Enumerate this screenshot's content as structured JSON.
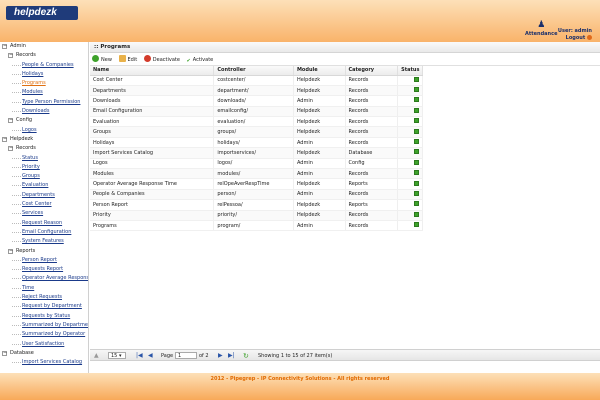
{
  "header": {
    "logo_text": "helpdezk",
    "attendance_label": "Attendance",
    "user_label": "User: admin",
    "logout_label": "Logout"
  },
  "sidebar": {
    "items": [
      {
        "label": "Admin",
        "type": "group",
        "level": 0,
        "toggle": "−"
      },
      {
        "label": "Records",
        "type": "group",
        "level": 1,
        "toggle": "−"
      },
      {
        "label": "People & Companies",
        "type": "leaf",
        "level": 2
      },
      {
        "label": "Holidays",
        "type": "leaf",
        "level": 2
      },
      {
        "label": "Programs",
        "type": "leaf",
        "level": 2,
        "active": true
      },
      {
        "label": "Modules",
        "type": "leaf",
        "level": 2
      },
      {
        "label": "Type Person Permission",
        "type": "leaf",
        "level": 2
      },
      {
        "label": "Downloads",
        "type": "leaf",
        "level": 2
      },
      {
        "label": "Config",
        "type": "group",
        "level": 1,
        "toggle": "−"
      },
      {
        "label": "Logos",
        "type": "leaf",
        "level": 2
      },
      {
        "label": "Helpdezk",
        "type": "group",
        "level": 0,
        "toggle": "−"
      },
      {
        "label": "Records",
        "type": "group",
        "level": 1,
        "toggle": "−"
      },
      {
        "label": "Status",
        "type": "leaf",
        "level": 2
      },
      {
        "label": "Priority",
        "type": "leaf",
        "level": 2
      },
      {
        "label": "Groups",
        "type": "leaf",
        "level": 2
      },
      {
        "label": "Evaluation",
        "type": "leaf",
        "level": 2
      },
      {
        "label": "Departments",
        "type": "leaf",
        "level": 2
      },
      {
        "label": "Cost Center",
        "type": "leaf",
        "level": 2
      },
      {
        "label": "Services",
        "type": "leaf",
        "level": 2
      },
      {
        "label": "Request Reason",
        "type": "leaf",
        "level": 2
      },
      {
        "label": "Email Configuration",
        "type": "leaf",
        "level": 2
      },
      {
        "label": "System Features",
        "type": "leaf",
        "level": 2
      },
      {
        "label": "Reports",
        "type": "group",
        "level": 1,
        "toggle": "−"
      },
      {
        "label": "Person Report",
        "type": "leaf",
        "level": 2
      },
      {
        "label": "Requests Report",
        "type": "leaf",
        "level": 2
      },
      {
        "label": "Operator Average Response",
        "type": "leaf",
        "level": 2
      },
      {
        "label": "Time",
        "type": "leaf",
        "level": 2
      },
      {
        "label": "Reject Requests",
        "type": "leaf",
        "level": 2
      },
      {
        "label": "Request by Department",
        "type": "leaf",
        "level": 2
      },
      {
        "label": "Requests by Status",
        "type": "leaf",
        "level": 2
      },
      {
        "label": "Summarized by Department",
        "type": "leaf",
        "level": 2
      },
      {
        "label": "Summarized by Operator",
        "type": "leaf",
        "level": 2
      },
      {
        "label": "User Satisfaction",
        "type": "leaf",
        "level": 2
      },
      {
        "label": "Database",
        "type": "group",
        "level": 0,
        "toggle": "−"
      },
      {
        "label": "Import Services Catalog",
        "type": "leaf",
        "level": 2
      }
    ]
  },
  "main": {
    "panel_title": "Programs",
    "toolbar": {
      "new_label": "New",
      "edit_label": "Edit",
      "deactivate_label": "Deactivate",
      "activate_label": "Activate"
    },
    "table": {
      "columns": [
        "Name",
        "Controller",
        "Module",
        "Category",
        "Status"
      ],
      "rows": [
        [
          "Cost Center",
          "costcenter/",
          "Helpdezk",
          "Records"
        ],
        [
          "Departments",
          "department/",
          "Helpdezk",
          "Records"
        ],
        [
          "Downloads",
          "downloads/",
          "Admin",
          "Records"
        ],
        [
          "Email Configuration",
          "emailconfig/",
          "Helpdezk",
          "Records"
        ],
        [
          "Evaluation",
          "evaluation/",
          "Helpdezk",
          "Records"
        ],
        [
          "Groups",
          "groups/",
          "Helpdezk",
          "Records"
        ],
        [
          "Holidays",
          "holidays/",
          "Admin",
          "Records"
        ],
        [
          "Import Services Catalog",
          "importservices/",
          "Helpdezk",
          "Database"
        ],
        [
          "Logos",
          "logos/",
          "Admin",
          "Config"
        ],
        [
          "Modules",
          "modules/",
          "Admin",
          "Records"
        ],
        [
          "Operator Average Response Time",
          "relOpeAverRespTime",
          "Helpdezk",
          "Reports"
        ],
        [
          "People & Companies",
          "person/",
          "Admin",
          "Records"
        ],
        [
          "Person Report",
          "relPessoa/",
          "Helpdezk",
          "Reports"
        ],
        [
          "Priority",
          "priority/",
          "Helpdezk",
          "Records"
        ],
        [
          "Programs",
          "program/",
          "Admin",
          "Records"
        ]
      ]
    },
    "pager": {
      "rows_per_page": "15",
      "page_label": "Page",
      "page_value": "1",
      "of_label": "of 2",
      "showing_text": "Showing 1 to 15 of 27 item(s)"
    }
  },
  "footer": {
    "text": "2012 - Pipegrep - IP Connectivity Solutions - All rights reserved"
  }
}
